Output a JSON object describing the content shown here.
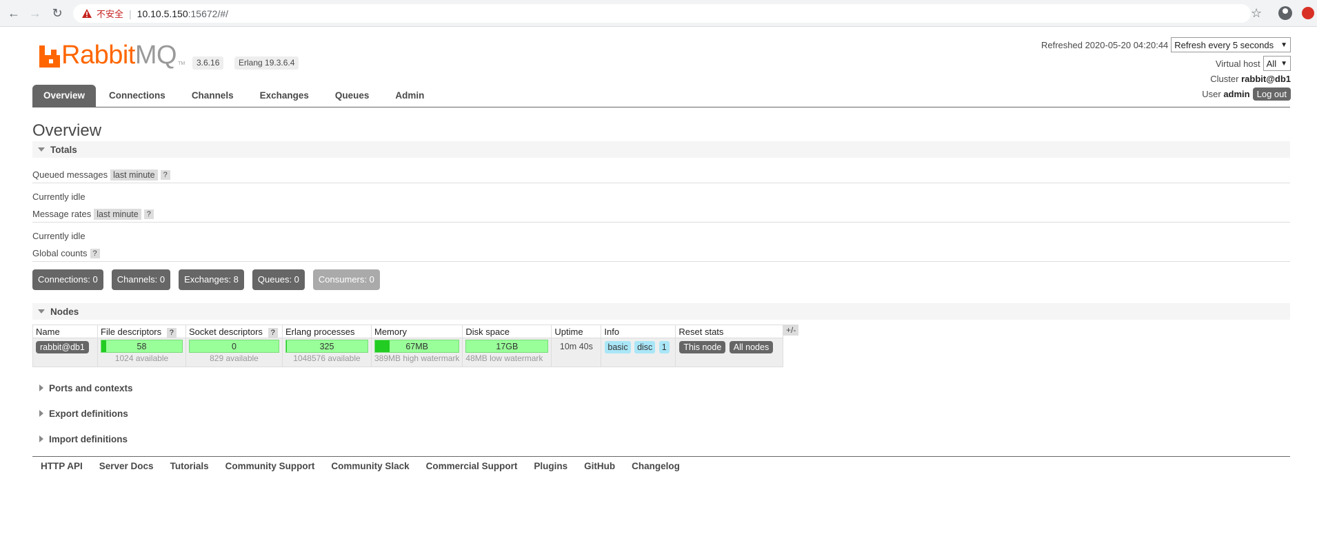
{
  "browser": {
    "insecure_label": "不安全",
    "url_host": "10.10.5.150",
    "url_path": ":15672/#/"
  },
  "header": {
    "logo_text_rabbit": "Rabbit",
    "logo_text_mq": "MQ",
    "version": "3.6.16",
    "erlang": "Erlang 19.3.6.4",
    "refreshed_label": "Refreshed",
    "refreshed_time": "2020-05-20 04:20:44",
    "refresh_select": "Refresh every 5 seconds",
    "vhost_label": "Virtual host",
    "vhost_select": "All",
    "cluster_label": "Cluster",
    "cluster_name": "rabbit@db1",
    "user_label": "User",
    "user_name": "admin",
    "logout": "Log out"
  },
  "tabs": [
    "Overview",
    "Connections",
    "Channels",
    "Exchanges",
    "Queues",
    "Admin"
  ],
  "page_title": "Overview",
  "totals": {
    "heading": "Totals",
    "queued_label": "Queued messages",
    "queued_range": "last minute",
    "help": "?",
    "queued_status": "Currently idle",
    "rates_label": "Message rates",
    "rates_range": "last minute",
    "rates_status": "Currently idle",
    "global_label": "Global counts"
  },
  "counts": [
    {
      "label": "Connections: 0"
    },
    {
      "label": "Channels: 0"
    },
    {
      "label": "Exchanges: 8"
    },
    {
      "label": "Queues: 0"
    },
    {
      "label": "Consumers: 0"
    }
  ],
  "nodes": {
    "heading": "Nodes",
    "columns": [
      "Name",
      "File descriptors",
      "Socket descriptors",
      "Erlang processes",
      "Memory",
      "Disk space",
      "Uptime",
      "Info",
      "Reset stats"
    ],
    "plus_minus": "+/-",
    "row": {
      "name": "rabbit@db1",
      "fd_value": "58",
      "fd_sub": "1024 available",
      "fd_fill": 0.06,
      "sock_value": "0",
      "sock_sub": "829 available",
      "sock_fill": 0,
      "proc_value": "325",
      "proc_sub": "1048576 available",
      "proc_fill": 0.01,
      "mem_value": "67MB",
      "mem_sub": "389MB high watermark",
      "mem_fill": 0.17,
      "disk_value": "17GB",
      "disk_sub": "48MB low watermark",
      "disk_fill": 0,
      "uptime": "10m 40s",
      "info": [
        "basic",
        "disc",
        "1"
      ],
      "reset_this": "This node",
      "reset_all": "All nodes"
    }
  },
  "collapsed_sections": [
    "Ports and contexts",
    "Export definitions",
    "Import definitions"
  ],
  "footer_links": [
    "HTTP API",
    "Server Docs",
    "Tutorials",
    "Community Support",
    "Community Slack",
    "Commercial Support",
    "Plugins",
    "GitHub",
    "Changelog"
  ],
  "colors": {
    "brand": "#ff6600",
    "tab_active": "#666666",
    "bar_green": "#99ff99",
    "info_tag": "#a9e6f7"
  }
}
